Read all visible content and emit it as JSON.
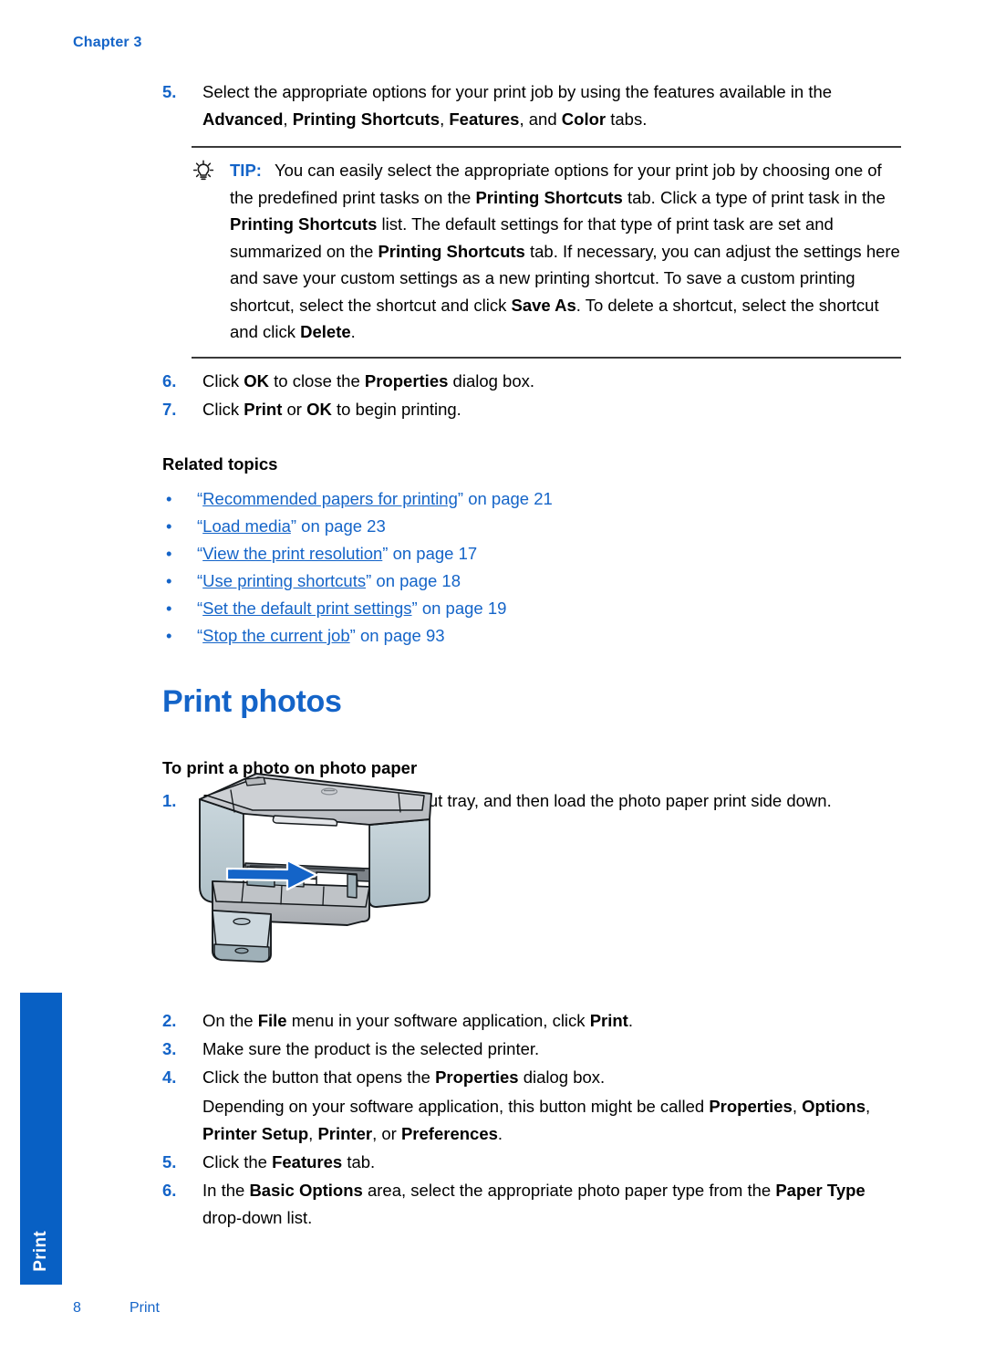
{
  "header": {
    "chapter": "Chapter 3"
  },
  "colors": {
    "accent_blue": "#1464C8",
    "tab_blue": "#0860C4",
    "rule_gray": "#3a3a3a"
  },
  "side_tab": {
    "label": "Print"
  },
  "footer": {
    "page_number": "8",
    "title": "Print"
  },
  "top_steps": [
    {
      "num": "5.",
      "parts": [
        {
          "t": "Select the appropriate options for your print job by using the features available in the ",
          "b": false
        },
        {
          "t": "Advanced",
          "b": true
        },
        {
          "t": ", ",
          "b": false
        },
        {
          "t": "Printing Shortcuts",
          "b": true
        },
        {
          "t": ", ",
          "b": false
        },
        {
          "t": "Features",
          "b": true
        },
        {
          "t": ", and ",
          "b": false
        },
        {
          "t": "Color",
          "b": true
        },
        {
          "t": " tabs.",
          "b": false
        }
      ]
    }
  ],
  "tip": {
    "icon": "lightbulb-icon",
    "label": "TIP:",
    "parts": [
      {
        "t": "You can easily select the appropriate options for your print job by choosing one of the predefined print tasks on the ",
        "b": false
      },
      {
        "t": "Printing Shortcuts",
        "b": true
      },
      {
        "t": " tab. Click a type of print task in the ",
        "b": false
      },
      {
        "t": "Printing Shortcuts",
        "b": true
      },
      {
        "t": " list. The default settings for that type of print task are set and summarized on the ",
        "b": false
      },
      {
        "t": "Printing Shortcuts",
        "b": true
      },
      {
        "t": " tab. If necessary, you can adjust the settings here and save your custom settings as a new printing shortcut. To save a custom printing shortcut, select the shortcut and click ",
        "b": false
      },
      {
        "t": "Save As",
        "b": true
      },
      {
        "t": ". To delete a shortcut, select the shortcut and click ",
        "b": false
      },
      {
        "t": "Delete",
        "b": true
      },
      {
        "t": ".",
        "b": false
      }
    ]
  },
  "post_tip_steps": [
    {
      "num": "6.",
      "parts": [
        {
          "t": "Click ",
          "b": false
        },
        {
          "t": "OK",
          "b": true
        },
        {
          "t": " to close the ",
          "b": false
        },
        {
          "t": "Properties",
          "b": true
        },
        {
          "t": " dialog box.",
          "b": false
        }
      ]
    },
    {
      "num": "7.",
      "parts": [
        {
          "t": "Click ",
          "b": false
        },
        {
          "t": "Print",
          "b": true
        },
        {
          "t": " or ",
          "b": false
        },
        {
          "t": "OK",
          "b": true
        },
        {
          "t": " to begin printing.",
          "b": false
        }
      ]
    }
  ],
  "related": {
    "heading": "Related topics",
    "bullet": "•",
    "items": [
      {
        "open_quote": "“",
        "link": "Recommended papers for printing",
        "close_quote": "”",
        "suffix": " on page 21"
      },
      {
        "open_quote": "“",
        "link": "Load media",
        "close_quote": "”",
        "suffix": " on page 23"
      },
      {
        "open_quote": "“",
        "link": "View the print resolution",
        "close_quote": "”",
        "suffix": " on page 17"
      },
      {
        "open_quote": "“",
        "link": "Use printing shortcuts",
        "close_quote": "”",
        "suffix": " on page 18"
      },
      {
        "open_quote": "“",
        "link": "Set the default print settings",
        "close_quote": "”",
        "suffix": " on page 19"
      },
      {
        "open_quote": "“",
        "link": "Stop the current job",
        "close_quote": "”",
        "suffix": " on page 93"
      }
    ]
  },
  "section": {
    "title": "Print photos",
    "procedure_heading": "To print a photo on photo paper"
  },
  "photo_steps_before_image": [
    {
      "num": "1.",
      "parts": [
        {
          "t": "Remove all paper from the input tray, and then load the photo paper print side down.",
          "b": false
        }
      ]
    }
  ],
  "illustration": {
    "name": "printer-load-photo-paper-illustration",
    "arrow": "blue-direction-arrow",
    "logo": "hp-logo"
  },
  "photo_steps_after_image": [
    {
      "num": "2.",
      "parts": [
        {
          "t": "On the ",
          "b": false
        },
        {
          "t": "File",
          "b": true
        },
        {
          "t": " menu in your software application, click ",
          "b": false
        },
        {
          "t": "Print",
          "b": true
        },
        {
          "t": ".",
          "b": false
        }
      ]
    },
    {
      "num": "3.",
      "parts": [
        {
          "t": "Make sure the product is the selected printer.",
          "b": false
        }
      ]
    },
    {
      "num": "4.",
      "parts": [
        {
          "t": "Click the button that opens the ",
          "b": false
        },
        {
          "t": "Properties",
          "b": true
        },
        {
          "t": " dialog box.",
          "b": false
        }
      ],
      "sub_parts": [
        {
          "t": "Depending on your software application, this button might be called ",
          "b": false
        },
        {
          "t": "Properties",
          "b": true
        },
        {
          "t": ", ",
          "b": false
        },
        {
          "t": "Options",
          "b": true
        },
        {
          "t": ", ",
          "b": false
        },
        {
          "t": "Printer Setup",
          "b": true
        },
        {
          "t": ", ",
          "b": false
        },
        {
          "t": "Printer",
          "b": true
        },
        {
          "t": ", or ",
          "b": false
        },
        {
          "t": "Preferences",
          "b": true
        },
        {
          "t": ".",
          "b": false
        }
      ]
    },
    {
      "num": "5.",
      "parts": [
        {
          "t": "Click the ",
          "b": false
        },
        {
          "t": "Features",
          "b": true
        },
        {
          "t": " tab.",
          "b": false
        }
      ]
    },
    {
      "num": "6.",
      "parts": [
        {
          "t": "In the ",
          "b": false
        },
        {
          "t": "Basic Options",
          "b": true
        },
        {
          "t": " area, select the appropriate photo paper type from the ",
          "b": false
        },
        {
          "t": "Paper Type",
          "b": true
        },
        {
          "t": " drop-down list.",
          "b": false
        }
      ]
    }
  ]
}
